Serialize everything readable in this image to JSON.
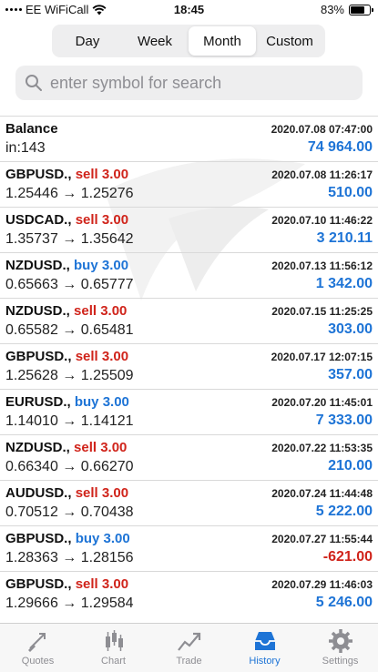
{
  "status": {
    "carrier": "EE WiFiCall",
    "time": "18:45",
    "battery": "83%"
  },
  "periods": [
    "Day",
    "Week",
    "Month",
    "Custom"
  ],
  "selected_period": "Month",
  "search": {
    "placeholder": "enter symbol for search"
  },
  "balance": {
    "label": "Balance",
    "sub": "in:143",
    "time": "2020.07.08 07:47:00",
    "amount": "74 964.00"
  },
  "deals": [
    {
      "symbol": "GBPUSD.,",
      "side": "sell",
      "side_text": "sell 3.00",
      "prices": "1.25446 → 1.25276",
      "time": "2020.07.08 11:26:17",
      "profit": "510.00"
    },
    {
      "symbol": "USDCAD.,",
      "side": "sell",
      "side_text": "sell 3.00",
      "prices": "1.35737 → 1.35642",
      "time": "2020.07.10 11:46:22",
      "profit": "3 210.11"
    },
    {
      "symbol": "NZDUSD.,",
      "side": "buy",
      "side_text": "buy 3.00",
      "prices": "0.65663 → 0.65777",
      "time": "2020.07.13 11:56:12",
      "profit": "1 342.00"
    },
    {
      "symbol": "NZDUSD.,",
      "side": "sell",
      "side_text": "sell 3.00",
      "prices": "0.65582 → 0.65481",
      "time": "2020.07.15 11:25:25",
      "profit": "303.00"
    },
    {
      "symbol": "GBPUSD.,",
      "side": "sell",
      "side_text": "sell 3.00",
      "prices": "1.25628 → 1.25509",
      "time": "2020.07.17 12:07:15",
      "profit": "357.00"
    },
    {
      "symbol": "EURUSD.,",
      "side": "buy",
      "side_text": "buy 3.00",
      "prices": "1.14010 → 1.14121",
      "time": "2020.07.20 11:45:01",
      "profit": "7 333.00"
    },
    {
      "symbol": "NZDUSD.,",
      "side": "sell",
      "side_text": "sell 3.00",
      "prices": "0.66340 → 0.66270",
      "time": "2020.07.22 11:53:35",
      "profit": "210.00"
    },
    {
      "symbol": "AUDUSD.,",
      "side": "sell",
      "side_text": "sell 3.00",
      "prices": "0.70512 → 0.70438",
      "time": "2020.07.24 11:44:48",
      "profit": "5 222.00"
    },
    {
      "symbol": "GBPUSD.,",
      "side": "buy",
      "side_text": "buy 3.00",
      "prices": "1.28363 → 1.28156",
      "time": "2020.07.27 11:55:44",
      "profit": "-621.00"
    },
    {
      "symbol": "GBPUSD.,",
      "side": "sell",
      "side_text": "sell 3.00",
      "prices": "1.29666 → 1.29584",
      "time": "2020.07.29 11:46:03",
      "profit": "5 246.00"
    }
  ],
  "tabs": [
    {
      "label": "Quotes",
      "icon": "quotes-icon"
    },
    {
      "label": "Chart",
      "icon": "chart-icon"
    },
    {
      "label": "Trade",
      "icon": "trade-icon"
    },
    {
      "label": "History",
      "icon": "history-icon"
    },
    {
      "label": "Settings",
      "icon": "gear-icon"
    }
  ],
  "active_tab": "History",
  "colors": {
    "sell": "#d0241b",
    "buy": "#1e74d6",
    "profit_positive": "#1e74d6",
    "profit_negative": "#d0241b",
    "accent": "#1e74d6"
  }
}
